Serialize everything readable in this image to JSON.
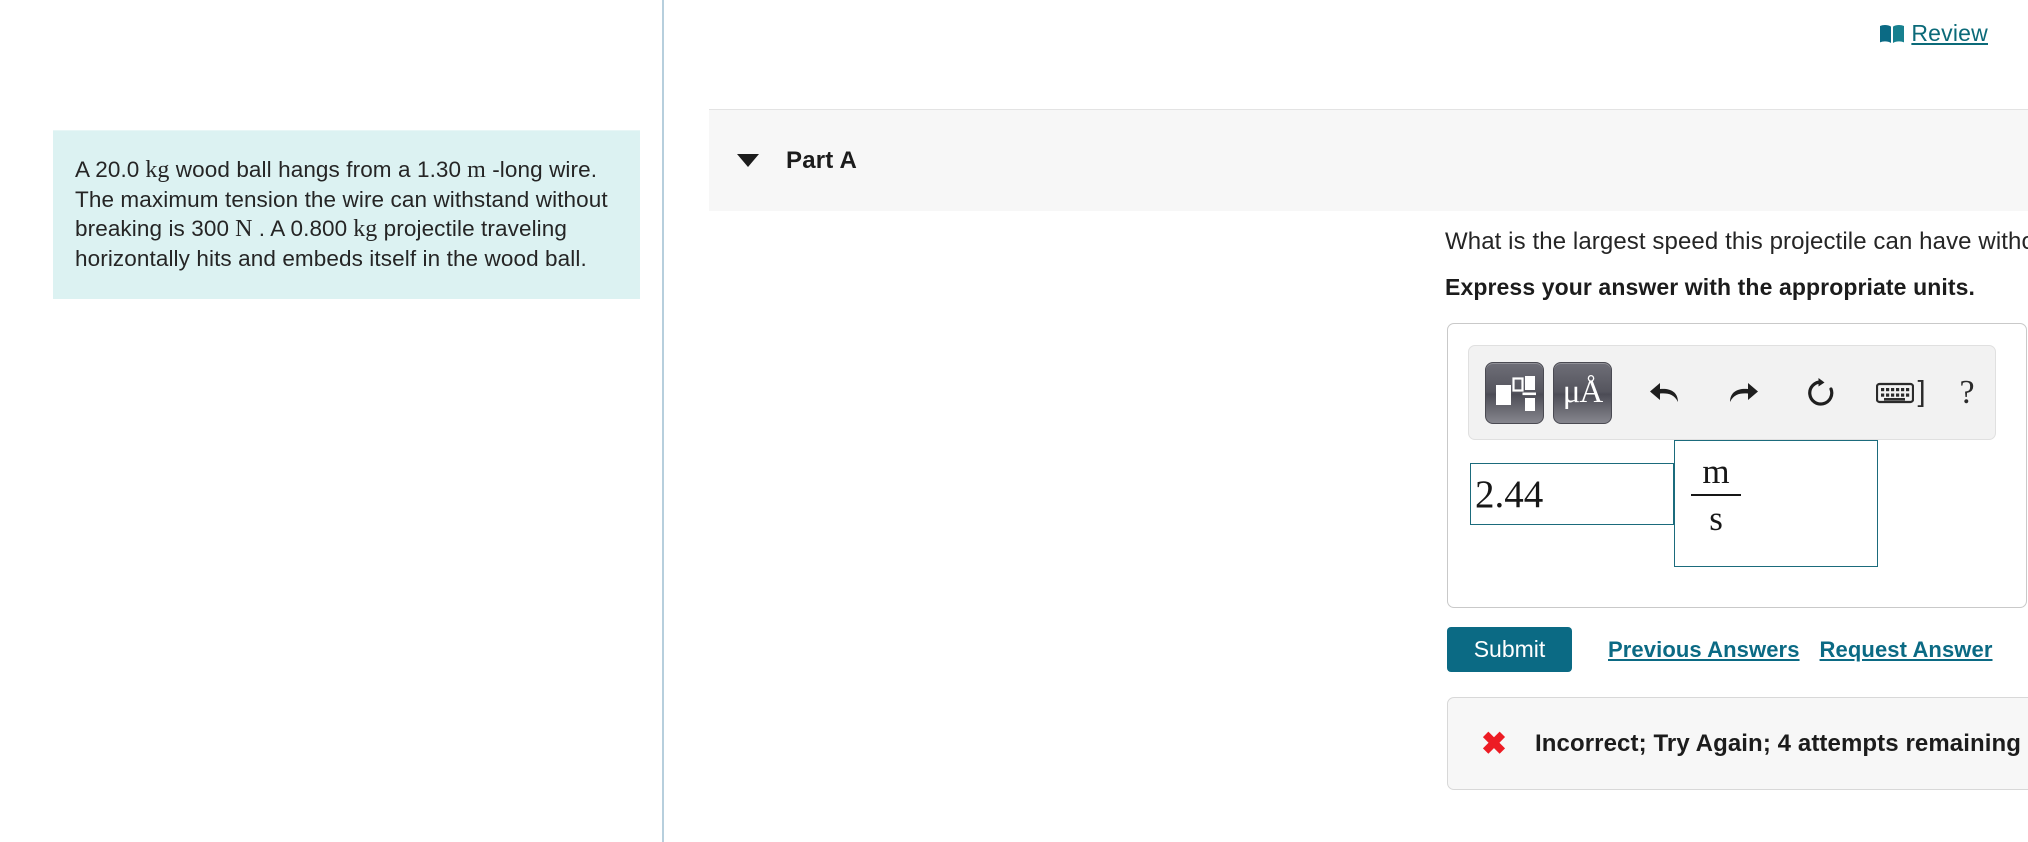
{
  "left": {
    "problem": {
      "segments": [
        {
          "t": "A ",
          "style": "normal"
        },
        {
          "t": "20.0",
          "style": "normal"
        },
        {
          "t": " kg",
          "style": "math"
        },
        {
          "t": " wood ball hangs from a ",
          "style": "normal"
        },
        {
          "t": "1.30",
          "style": "normal"
        },
        {
          "t": " m",
          "style": "math"
        },
        {
          "t": " -long wire. The maximum tension the wire can withstand without breaking is ",
          "style": "normal"
        },
        {
          "t": "300",
          "style": "normal"
        },
        {
          "t": " N",
          "style": "math"
        },
        {
          "t": " . A ",
          "style": "normal"
        },
        {
          "t": "0.800",
          "style": "normal"
        },
        {
          "t": " kg",
          "style": "math"
        },
        {
          "t": " projectile traveling horizontally hits and embeds itself in the wood ball.",
          "style": "normal"
        }
      ],
      "plain_text": "A 20.0 kg wood ball hangs from a 1.30 m -long wire. The maximum tension the wire can withstand without breaking is 300 N . A 0.800 kg projectile traveling horizontally hits and embeds itself in the wood ball."
    }
  },
  "header": {
    "review_label": "Review",
    "review_icon": "book-icon"
  },
  "part": {
    "title": "Part A",
    "toggle_icon": "chevron-down-icon",
    "question": "What is the largest speed this projectile can have without causing the cable to break?",
    "instruction": "Express your answer with the appropriate units."
  },
  "answer": {
    "toolbar": {
      "template_button": "math-template-icon",
      "units_button": "μÅ",
      "undo_icon": "undo-arrow-icon",
      "redo_icon": "redo-arrow-icon",
      "reset_icon": "reset-circular-arrow-icon",
      "keyboard_icon": "keyboard-icon",
      "bracket_glyph": "]",
      "help_glyph": "?"
    },
    "value": "2.44",
    "unit_numerator": "m",
    "unit_denominator": "s"
  },
  "actions": {
    "submit_label": "Submit",
    "previous_answers_label": "Previous Answers",
    "request_answer_label": "Request Answer"
  },
  "feedback": {
    "icon": "✖",
    "message": "Incorrect; Try Again; 4 attempts remaining"
  },
  "colors": {
    "accent_teal": "#0b6a84",
    "problem_bg": "#dcf2f2",
    "error_red": "#ed1c24",
    "field_border": "#1b6b7c",
    "divider": "#b7cfdd"
  }
}
